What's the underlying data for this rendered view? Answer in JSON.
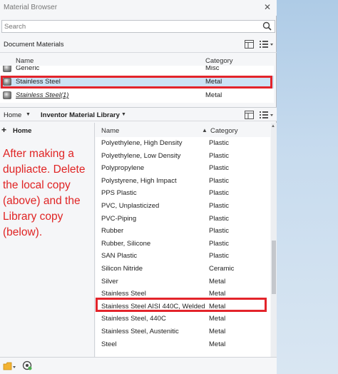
{
  "window": {
    "title": "Material Browser"
  },
  "search": {
    "placeholder": "Search"
  },
  "document_materials": {
    "label": "Document Materials",
    "columns": {
      "name": "Name",
      "category": "Category"
    },
    "rows": [
      {
        "name": "Generic",
        "category": "Misc"
      },
      {
        "name": "Stainless Steel",
        "category": "Metal"
      },
      {
        "name": "Stainless Steel(1)",
        "category": "Metal"
      }
    ]
  },
  "library_bar": {
    "home": "Home",
    "library": "Inventor Material Library"
  },
  "tree": {
    "home": "Home"
  },
  "annotation": "After making a dupliacte. Delete the local copy (above) and the Library copy (below).",
  "library_materials": {
    "columns": {
      "name": "Name",
      "category": "Category"
    },
    "rows": [
      {
        "name": "Polyethylene, High Density",
        "category": "Plastic"
      },
      {
        "name": "Polyethylene, Low Density",
        "category": "Plastic"
      },
      {
        "name": "Polypropylene",
        "category": "Plastic"
      },
      {
        "name": "Polystyrene, High Impact",
        "category": "Plastic"
      },
      {
        "name": "PPS Plastic",
        "category": "Plastic"
      },
      {
        "name": "PVC, Unplasticized",
        "category": "Plastic"
      },
      {
        "name": "PVC-Piping",
        "category": "Plastic"
      },
      {
        "name": "Rubber",
        "category": "Plastic"
      },
      {
        "name": "Rubber, Silicone",
        "category": "Plastic"
      },
      {
        "name": "SAN Plastic",
        "category": "Plastic"
      },
      {
        "name": "Silicon Nitride",
        "category": "Ceramic"
      },
      {
        "name": "Silver",
        "category": "Metal"
      },
      {
        "name": "Stainless Steel",
        "category": "Metal"
      },
      {
        "name": "Stainless Steel AISI 440C, Welded",
        "category": "Metal"
      },
      {
        "name": "Stainless Steel, 440C",
        "category": "Metal"
      },
      {
        "name": "Stainless Steel, Austenitic",
        "category": "Metal"
      },
      {
        "name": "Steel",
        "category": "Metal"
      }
    ]
  },
  "colors": {
    "highlight": "#e3242b",
    "selection": "#cce3f5"
  }
}
